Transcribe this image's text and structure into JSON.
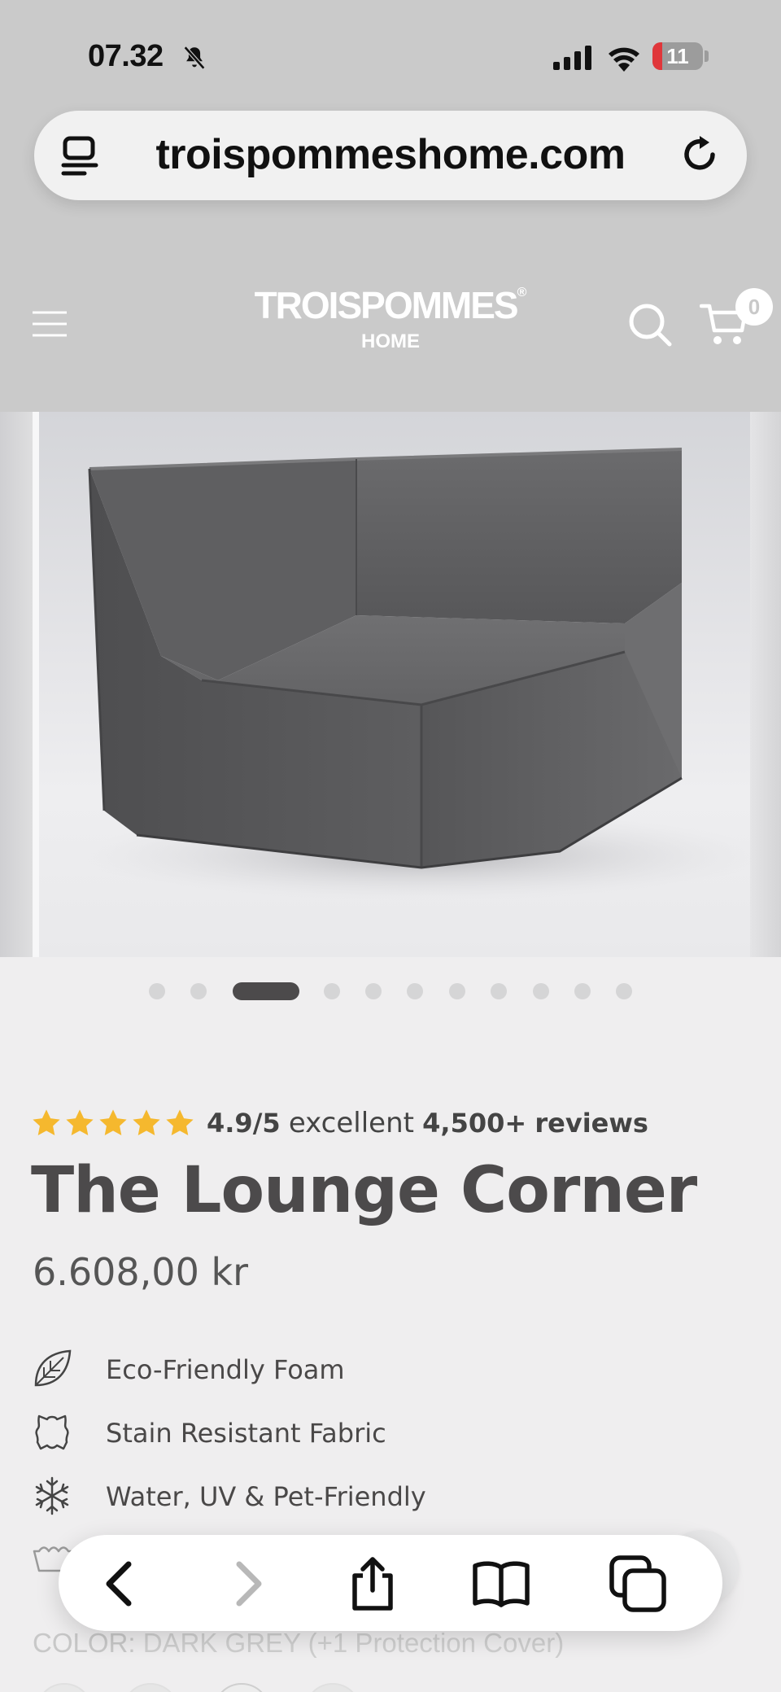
{
  "status_bar": {
    "time": "07.32",
    "battery": "11",
    "icons": [
      "bell-slash-icon",
      "cellular-signal-icon",
      "wifi-icon",
      "battery-icon"
    ]
  },
  "browser": {
    "url": "troispommeshome.com",
    "toolbar": [
      "back-arrow-icon",
      "forward-arrow-icon",
      "share-icon",
      "bookmarks-book-icon",
      "tabs-icon"
    ]
  },
  "header": {
    "brand": "TROISPOMMES",
    "registered": "®",
    "brand_sub": "HOME",
    "cart_count": "0",
    "icons": [
      "hamburger-menu-icon",
      "search-icon",
      "cart-icon"
    ]
  },
  "gallery": {
    "slide_count": 11,
    "active_index": 2,
    "image": "dark grey corner lounge chair"
  },
  "product": {
    "rating_value": "4.9",
    "rating_scale": "/5",
    "rating_word": "excellent",
    "reviews_count": "4,500+",
    "reviews_word": "reviews",
    "title": "The Lounge Corner",
    "price": "6.608,00 kr",
    "features": [
      {
        "icon": "leaf-icon",
        "label": "Eco-Friendly Foam"
      },
      {
        "icon": "leather-hide-icon",
        "label": "Stain Resistant Fabric"
      },
      {
        "icon": "snowflake-icon",
        "label": "Water, UV & Pet-Friendly"
      }
    ],
    "covered_feature_icon": "washing-basin-icon",
    "color_label": "COLOR:",
    "color_value": "DARK GREY (+1 Protection Cover)"
  },
  "colors": {
    "star": "#f5b82e",
    "text_dark": "#4c4a4b",
    "chrome_bg": "#cacaca",
    "page_bg": "#efeeef"
  }
}
